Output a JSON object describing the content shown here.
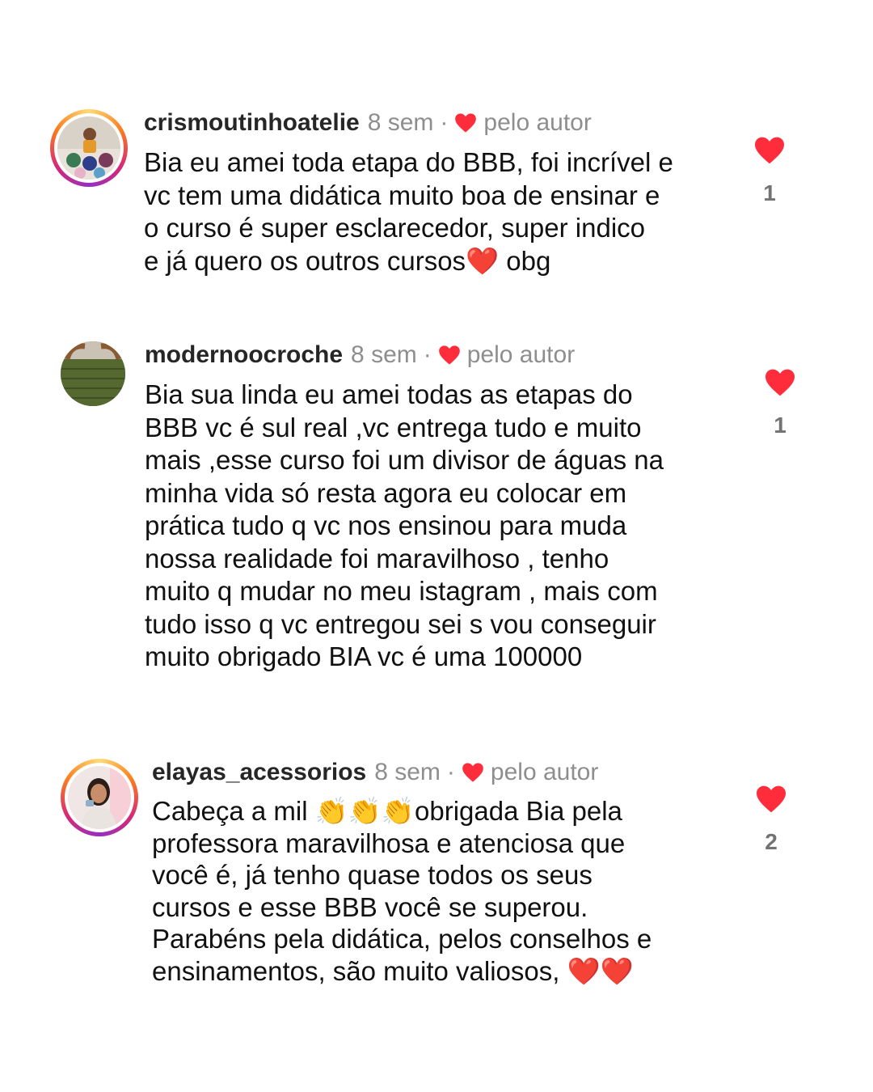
{
  "comments": [
    {
      "username": "crismoutinhoatelie",
      "time": "8 sem",
      "separator": "·",
      "author_label": "pelo autor",
      "lines": [
        "Bia eu amei toda etapa do BBB, foi incrível e",
        "vc tem uma didática muito boa de ensinar e",
        "o curso é super esclarecedor, super indico",
        "e já quero os outros cursos❤️ obg"
      ],
      "likes": "1"
    },
    {
      "username": "modernoocroche",
      "time": "8 sem",
      "separator": "·",
      "author_label": "pelo autor",
      "lines": [
        "Bia sua linda eu amei todas as etapas do",
        "BBB vc é sul real ,vc entrega tudo e muito",
        "mais ,esse curso foi um divisor de águas na",
        "minha vida só resta agora eu colocar em",
        "prática tudo q vc nos ensinou para muda",
        "nossa realidade foi maravilhoso , tenho",
        "muito q mudar no meu istagram , mais com",
        "tudo isso q vc entregou sei s vou conseguir",
        "muito obrigado BIA vc é uma 100000"
      ],
      "likes": "1"
    },
    {
      "username": "elayas_acessorios",
      "time": "8 sem",
      "separator": "·",
      "author_label": "pelo autor",
      "lines": [
        "Cabeça a mil 👏👏👏obrigada Bia pela",
        "professora maravilhosa e atenciosa que",
        "você é, já tenho quase todos os seus",
        "cursos e esse BBB você se superou.",
        "Parabéns pela didática, pelos conselhos e",
        "ensinamentos, são muito valiosos, ❤️❤️"
      ],
      "likes": "2"
    }
  ],
  "colors": {
    "like_red": "#ff2d3b",
    "meta_gray": "#8e8e8e"
  },
  "icons": {
    "like": "heart-icon",
    "author_like": "heart-icon"
  }
}
